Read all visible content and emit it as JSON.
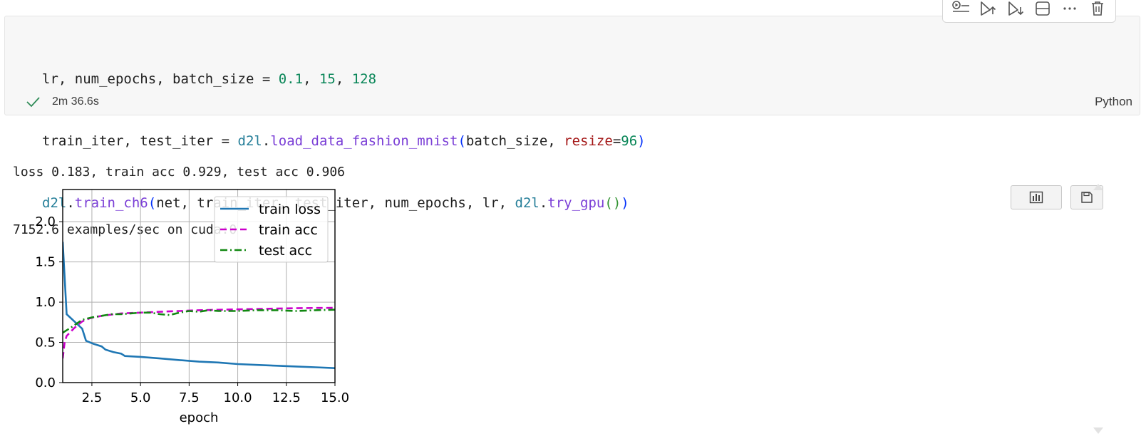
{
  "toolbar": {
    "buttons": [
      {
        "icon": "run-by-line-icon"
      },
      {
        "icon": "execute-above-icon"
      },
      {
        "icon": "execute-below-icon"
      },
      {
        "icon": "split-cell-icon"
      },
      {
        "icon": "more-icon"
      },
      {
        "icon": "delete-icon"
      }
    ]
  },
  "cell": {
    "code": {
      "line1": {
        "a": "lr, num_epochs, batch_size = ",
        "n1": "0.1",
        "c1": ", ",
        "n2": "15",
        "c2": ", ",
        "n3": "128"
      },
      "line2": {
        "a": "train_iter, test_iter = ",
        "mod": "d2l",
        "dot": ".",
        "fn": "load_data_fashion_mnist",
        "p1": "(",
        "b": "batch_size, ",
        "kw": "resize",
        "eq": "=",
        "n": "96",
        "p2": ")"
      },
      "line3": {
        "mod": "d2l",
        "dot": ".",
        "fn": "train_ch6",
        "p1": "(",
        "b": "net, train_iter, test_iter, num_epochs, lr, ",
        "mod2": "d2l",
        "dot2": ".",
        "fn2": "try_gpu",
        "p3": "(",
        "p4": ")",
        "p2": ")"
      }
    },
    "status": {
      "duration": "2m 36.6s",
      "icon": "check-icon"
    },
    "language": "Python"
  },
  "output": {
    "lines": [
      "loss 0.183, train acc 0.929, test acc 0.906",
      "7152.6 examples/sec on cuda:0"
    ],
    "actions": [
      {
        "icon": "chart-icon"
      },
      {
        "icon": "save-icon"
      }
    ]
  },
  "colors": {
    "train_loss": "#1f77b4",
    "train_acc": "#cc00cc",
    "test_acc": "#118811"
  },
  "chart_data": {
    "type": "line",
    "xlabel": "epoch",
    "xlim": [
      1,
      15
    ],
    "ylim": [
      0,
      2.4
    ],
    "xticks": [
      2.5,
      5.0,
      7.5,
      10.0,
      12.5,
      15.0
    ],
    "xtick_labels": [
      "2.5",
      "5.0",
      "7.5",
      "10.0",
      "12.5",
      "15.0"
    ],
    "yticks": [
      0.0,
      0.5,
      1.0,
      1.5,
      2.0
    ],
    "ytick_labels": [
      "0.0",
      "0.5",
      "1.0",
      "1.5",
      "2.0"
    ],
    "grid": true,
    "legend": "top-right",
    "series": [
      {
        "name": "train loss",
        "style": "solid",
        "x": [
          1.0,
          1.2,
          1.6,
          2.0,
          2.2,
          2.6,
          3.0,
          3.2,
          3.6,
          4.0,
          4.2,
          5.0,
          6.0,
          7.0,
          8.0,
          9.0,
          10.0,
          11.0,
          12.0,
          13.0,
          14.0,
          15.0
        ],
        "y": [
          1.75,
          0.85,
          0.76,
          0.67,
          0.52,
          0.48,
          0.45,
          0.41,
          0.38,
          0.36,
          0.33,
          0.32,
          0.3,
          0.28,
          0.26,
          0.25,
          0.23,
          0.22,
          0.21,
          0.2,
          0.19,
          0.18
        ]
      },
      {
        "name": "train acc",
        "style": "dashed",
        "x": [
          1.0,
          1.1,
          1.2,
          1.6,
          2.0,
          2.4,
          3.0,
          4.0,
          5.0,
          6.0,
          7.0,
          8.0,
          9.0,
          10.0,
          11.0,
          12.0,
          13.0,
          14.0,
          15.0
        ],
        "y": [
          0.3,
          0.5,
          0.58,
          0.68,
          0.76,
          0.8,
          0.83,
          0.86,
          0.87,
          0.88,
          0.89,
          0.9,
          0.905,
          0.91,
          0.915,
          0.92,
          0.925,
          0.928,
          0.929
        ]
      },
      {
        "name": "test acc",
        "style": "dashdot",
        "x": [
          1.0,
          1.4,
          2.0,
          2.5,
          3.0,
          3.5,
          4.0,
          5.0,
          5.5,
          6.0,
          6.5,
          7.0,
          7.5,
          8.0,
          8.5,
          9.0,
          10.0,
          11.0,
          12.0,
          13.0,
          14.0,
          15.0
        ],
        "y": [
          0.62,
          0.68,
          0.78,
          0.81,
          0.83,
          0.85,
          0.85,
          0.87,
          0.87,
          0.85,
          0.84,
          0.87,
          0.89,
          0.88,
          0.9,
          0.89,
          0.89,
          0.9,
          0.9,
          0.89,
          0.9,
          0.906
        ]
      }
    ]
  }
}
